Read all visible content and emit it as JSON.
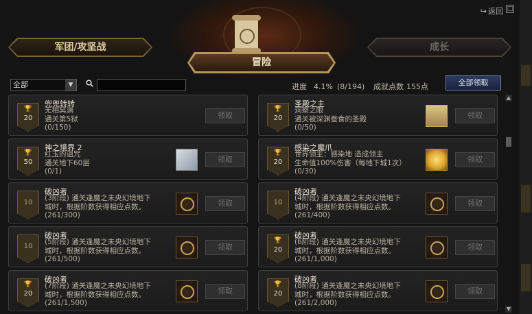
{
  "header": {
    "back_label": "返回",
    "back_icon": "↪",
    "tabs": {
      "left": "军团/攻坚战",
      "center": "冒险",
      "right": "成长"
    }
  },
  "filter": {
    "select_value": "全部",
    "search_placeholder": ""
  },
  "stats": {
    "progress_label": "进度",
    "progress_percent": "4.1%",
    "progress_count": "(8/194)",
    "points_label": "成就点数",
    "points_value": "155点"
  },
  "claim_all_label": "全部领取",
  "claim_label": "领取",
  "achievements": [
    {
      "title": "兜兜转转",
      "desc": "无相冥渊\n通关第5狱",
      "progress": "(0/150)",
      "points": "20",
      "trophy": true,
      "icon": "none"
    },
    {
      "title": "圣殿之主",
      "desc": "洞察之眼\n通关被深渊蚕食的圣殿",
      "progress": "(0/50)",
      "points": "20",
      "trophy": true,
      "icon": "mask"
    },
    {
      "title": "神之境界 2",
      "desc": "红玉的诅咒\n通关地下60层",
      "progress": "(0/1)",
      "points": "50",
      "trophy": true,
      "icon": "scroll"
    },
    {
      "title": "感染之魔爪",
      "desc": "世界领主：感染地        造成领主\n生命值100%伤害（每地下城1次）",
      "progress": "(0/30)",
      "points": "20",
      "trophy": true,
      "icon": "burst"
    },
    {
      "title": "破凶者",
      "desc": "(3阶段) 通关逢魔之未央幻境地下\n城时，根据阶数获得相应点数。",
      "progress": "(261/300)",
      "points": "10",
      "trophy": false,
      "icon": "seal"
    },
    {
      "title": "破凶者",
      "desc": "(4阶段) 通关逢魔之未央幻境地下\n城时，根据阶数获得相应点数。",
      "progress": "(261/400)",
      "points": "10",
      "trophy": false,
      "icon": "seal"
    },
    {
      "title": "破凶者",
      "desc": "(5阶段) 通关逢魔之未央幻境地下\n城时，根据阶数获得相应点数。",
      "progress": "(261/500)",
      "points": "10",
      "trophy": false,
      "icon": "seal"
    },
    {
      "title": "破凶者",
      "desc": "(6阶段) 通关逢魔之未央幻境地下\n城时，根据阶数获得相应点数。",
      "progress": "(261/1,000)",
      "points": "20",
      "trophy": true,
      "icon": "seal"
    },
    {
      "title": "破凶者",
      "desc": "(7阶段) 通关逢魔之未央幻境地下\n城时，根据阶数获得相应点数。",
      "progress": "(261/1,500)",
      "points": "20",
      "trophy": true,
      "icon": "seal"
    },
    {
      "title": "破凶者",
      "desc": "(8阶段) 通关逢魔之未央幻境地下\n城时，根据阶数获得相应点数。",
      "progress": "(261/2,000)",
      "points": "20",
      "trophy": true,
      "icon": "seal"
    }
  ]
}
